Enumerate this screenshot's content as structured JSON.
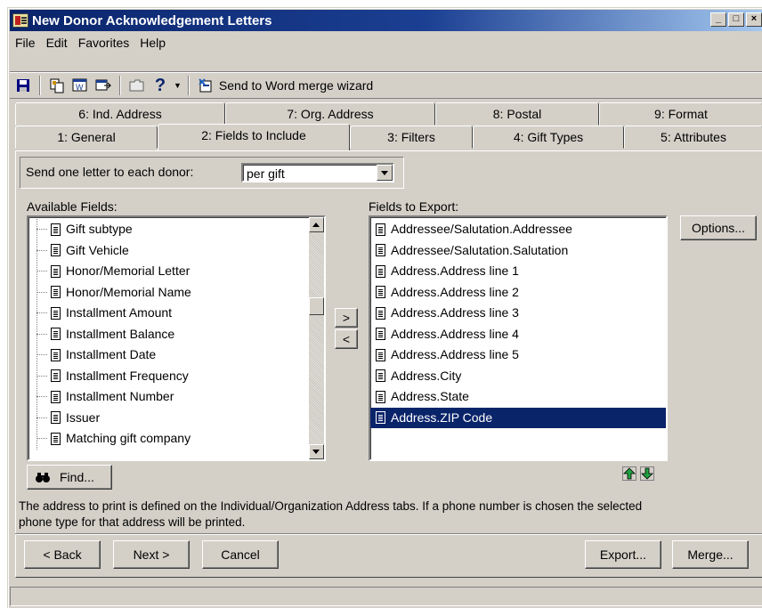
{
  "window": {
    "title": "New Donor Acknowledgement Letters"
  },
  "menu": [
    "File",
    "Edit",
    "Favorites",
    "Help"
  ],
  "toolbar": {
    "wizard_label": "Send to Word merge wizard"
  },
  "tabs": {
    "row1": [
      "6: Ind. Address",
      "7: Org. Address",
      "8: Postal",
      "9: Format"
    ],
    "row2": [
      "1: General",
      "2: Fields to Include",
      "3: Filters",
      "4: Gift Types",
      "5: Attributes"
    ],
    "active": "2: Fields to Include"
  },
  "general": {
    "send_one_label": "Send one letter to each donor:",
    "send_one_value": "per gift"
  },
  "available": {
    "label": "Available Fields:",
    "items": [
      "Gift subtype",
      "Gift Vehicle",
      "Honor/Memorial Letter",
      "Honor/Memorial Name",
      "Installment Amount",
      "Installment Balance",
      "Installment Date",
      "Installment Frequency",
      "Installment Number",
      "Issuer",
      "Matching gift company"
    ]
  },
  "export": {
    "label": "Fields to Export:",
    "items": [
      "Addressee/Salutation.Addressee",
      "Addressee/Salutation.Salutation",
      "Address.Address line 1",
      "Address.Address line 2",
      "Address.Address line 3",
      "Address.Address line 4",
      "Address.Address line 5",
      "Address.City",
      "Address.State",
      "Address.ZIP Code"
    ],
    "selected_index": 9
  },
  "buttons": {
    "options": "Options...",
    "add": ">",
    "remove": "<",
    "find": "Find...",
    "back": "< Back",
    "next": "Next >",
    "cancel": "Cancel",
    "export": "Export...",
    "merge": "Merge..."
  },
  "note": "The address to print is defined on the Individual/Organization Address tabs. If a phone number is chosen the selected phone type for that address will be printed.",
  "colors": {
    "titlebar": "#0a246a",
    "selection": "#0a246a",
    "face": "#d4d0c8"
  }
}
